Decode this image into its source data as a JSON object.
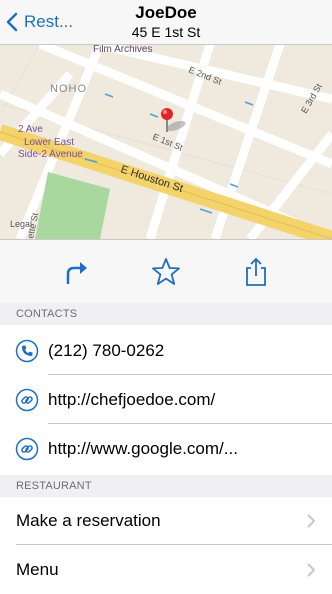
{
  "nav": {
    "back_label": "Rest...",
    "title": "JoeDoe",
    "subtitle": "45 E 1st St"
  },
  "map": {
    "labels": {
      "film_archives": "Film Archives",
      "noho": "NOHO",
      "e2nd": "E 2nd St",
      "e1st": "E 1st St",
      "e3rd": "E 3rd St",
      "ave2": "2 Ave",
      "lower_east": "Lower East",
      "side2ave": "Side-2 Avenue",
      "houston": "E Houston St",
      "legal": "Legal",
      "lafayette_st": "ette St"
    }
  },
  "actions": {
    "directions_icon": "directions-arrow-icon",
    "favorite_icon": "star-icon",
    "share_icon": "share-icon"
  },
  "contacts": {
    "header": "CONTACTS",
    "phone": "(212) 780-0262",
    "url1": "http://chefjoedoe.com/",
    "url2": "http://www.google.com/..."
  },
  "restaurant": {
    "header": "RESTAURANT",
    "reservation": "Make a reservation",
    "menu": "Menu"
  },
  "colors": {
    "accent": "#1e6fc1",
    "pin": "#e0262b"
  }
}
